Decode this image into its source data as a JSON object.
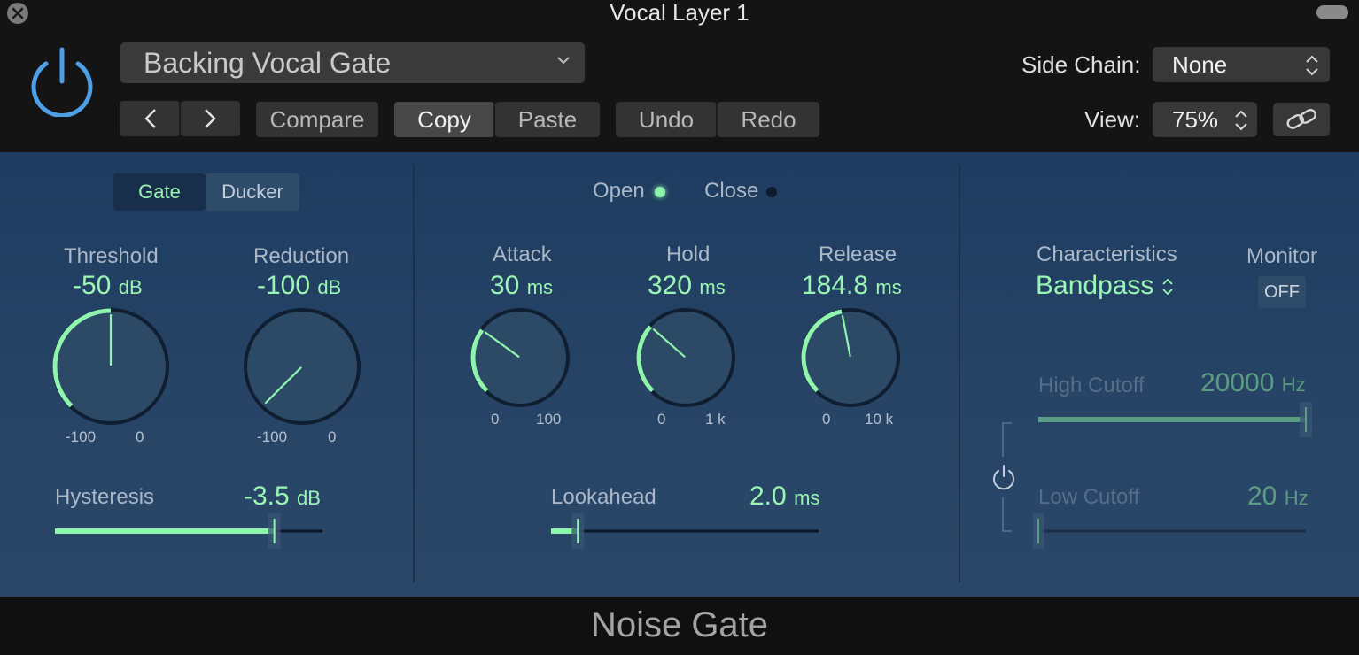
{
  "window": {
    "title": "Vocal Layer 1"
  },
  "header": {
    "preset": "Backing Vocal Gate",
    "nav_prev": "<",
    "nav_next": ">",
    "compare": "Compare",
    "copy": "Copy",
    "paste": "Paste",
    "undo": "Undo",
    "redo": "Redo",
    "side_chain_label": "Side Chain:",
    "side_chain_value": "None",
    "view_label": "View:",
    "view_value": "75%"
  },
  "mode": {
    "options": [
      "Gate",
      "Ducker"
    ],
    "selected": "Gate"
  },
  "knobs": {
    "threshold": {
      "label": "Threshold",
      "value": "-50",
      "unit": "dB",
      "min_label": "-100",
      "max_label": "0",
      "min": -100,
      "max": 0,
      "current": -50
    },
    "reduction": {
      "label": "Reduction",
      "value": "-100",
      "unit": "dB",
      "min_label": "-100",
      "max_label": "0",
      "min": -100,
      "max": 0,
      "current": -100
    },
    "attack": {
      "label": "Attack",
      "value": "30",
      "unit": "ms",
      "min_label": "0",
      "max_label": "100",
      "fraction": 0.3
    },
    "hold": {
      "label": "Hold",
      "value": "320",
      "unit": "ms",
      "min_label": "0",
      "max_label": "1 k",
      "fraction": 0.32
    },
    "release": {
      "label": "Release",
      "value": "184.8",
      "unit": "ms",
      "min_label": "0",
      "max_label": "10 k",
      "fraction": 0.46
    }
  },
  "indicators": {
    "open": {
      "label": "Open",
      "active": true
    },
    "close": {
      "label": "Close",
      "active": false
    }
  },
  "sliders": {
    "hysteresis": {
      "label": "Hysteresis",
      "value": "-3.5",
      "unit": "dB",
      "fraction": 0.82
    },
    "lookahead": {
      "label": "Lookahead",
      "value": "2.0",
      "unit": "ms",
      "fraction": 0.1
    },
    "high_cutoff": {
      "label": "High Cutoff",
      "value": "20000",
      "unit": "Hz",
      "fraction": 1.0
    },
    "low_cutoff": {
      "label": "Low Cutoff",
      "value": "20",
      "unit": "Hz",
      "fraction": 0.0
    }
  },
  "sidechain_filter": {
    "characteristics_label": "Characteristics",
    "characteristics_value": "Bandpass",
    "monitor_label": "Monitor",
    "monitor_value": "OFF"
  },
  "colors": {
    "accent": "#8ff5ad",
    "panel": "#274466",
    "header": "#141414",
    "power_blue": "#4d9fe6"
  },
  "footer": {
    "plugin_name": "Noise Gate"
  }
}
